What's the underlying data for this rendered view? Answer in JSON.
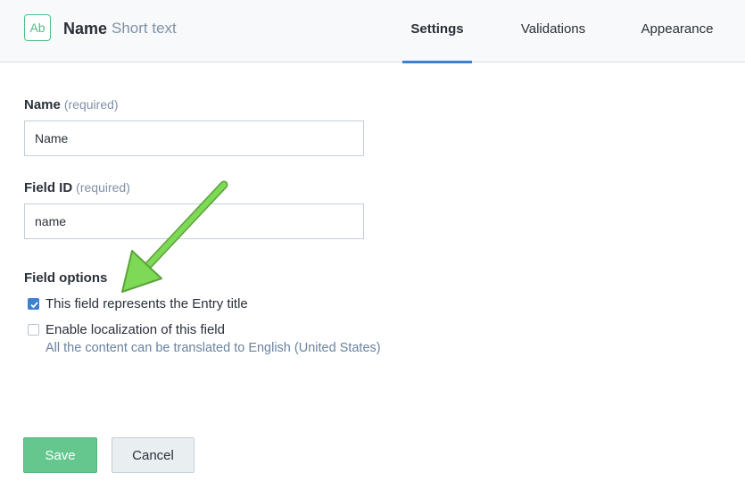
{
  "header": {
    "type_icon": "Ab",
    "field_name": "Name",
    "field_type": "Short text",
    "tabs": [
      {
        "label": "Settings",
        "active": true
      },
      {
        "label": "Validations",
        "active": false
      },
      {
        "label": "Appearance",
        "active": false
      }
    ]
  },
  "form": {
    "name": {
      "label": "Name",
      "required": "(required)",
      "value": "Name"
    },
    "field_id": {
      "label": "Field ID",
      "required": "(required)",
      "value": "name"
    },
    "options": {
      "heading": "Field options",
      "items": [
        {
          "label": "This field represents the Entry title",
          "checked": true
        },
        {
          "label": "Enable localization of this field",
          "checked": false,
          "hint": "All the content can be translated to English (United States)"
        }
      ]
    }
  },
  "actions": {
    "save": "Save",
    "cancel": "Cancel"
  },
  "colors": {
    "accent": "#3c80cf",
    "save": "#65c78e",
    "annotation_arrow": "#7ed957"
  }
}
